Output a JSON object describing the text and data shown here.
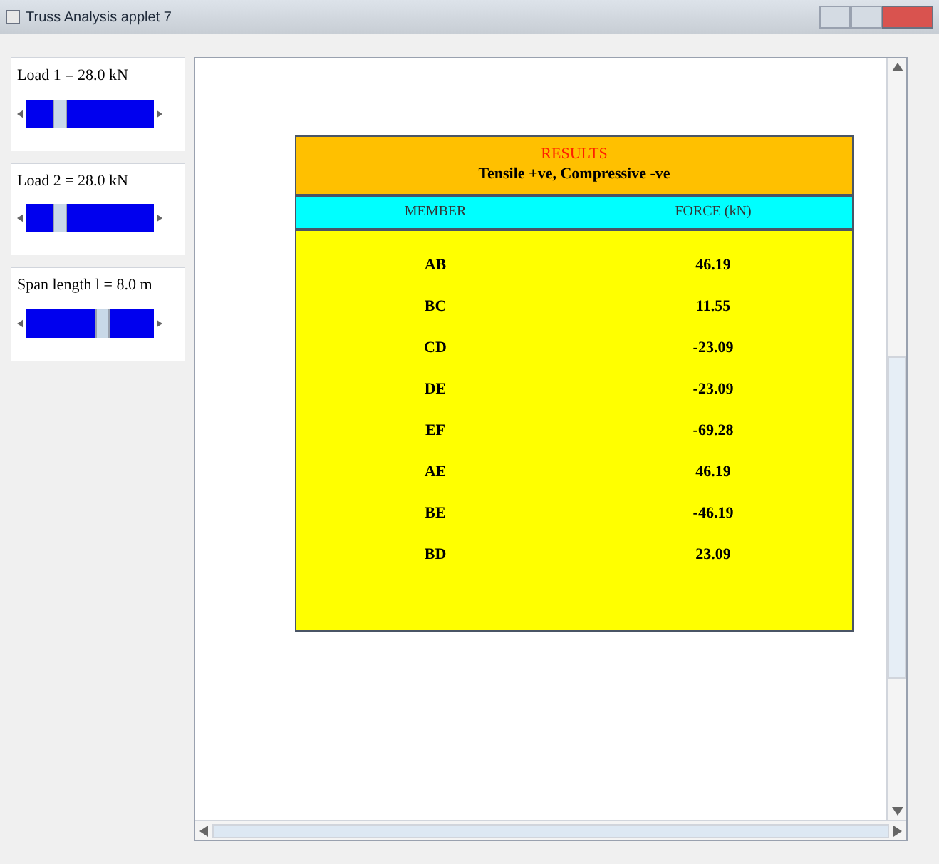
{
  "window": {
    "title": "Truss Analysis applet 7"
  },
  "sliders": [
    {
      "label": "Load 1 =  28.0 kN",
      "level": 0.27
    },
    {
      "label": "Load 2 =  28.0 kN",
      "level": 0.27
    },
    {
      "label": "Span length l = 8.0 m",
      "level": 0.6
    }
  ],
  "results": {
    "title": "RESULTS",
    "subtitle": "Tensile +ve, Compressive -ve",
    "columns": [
      "MEMBER",
      "FORCE (kN)"
    ],
    "rows": [
      [
        "AB",
        "46.19"
      ],
      [
        "BC",
        "11.55"
      ],
      [
        "CD",
        "-23.09"
      ],
      [
        "DE",
        "-23.09"
      ],
      [
        "EF",
        "-69.28"
      ],
      [
        "AE",
        "46.19"
      ],
      [
        "BE",
        "-46.19"
      ],
      [
        "BD",
        "23.09"
      ]
    ]
  }
}
